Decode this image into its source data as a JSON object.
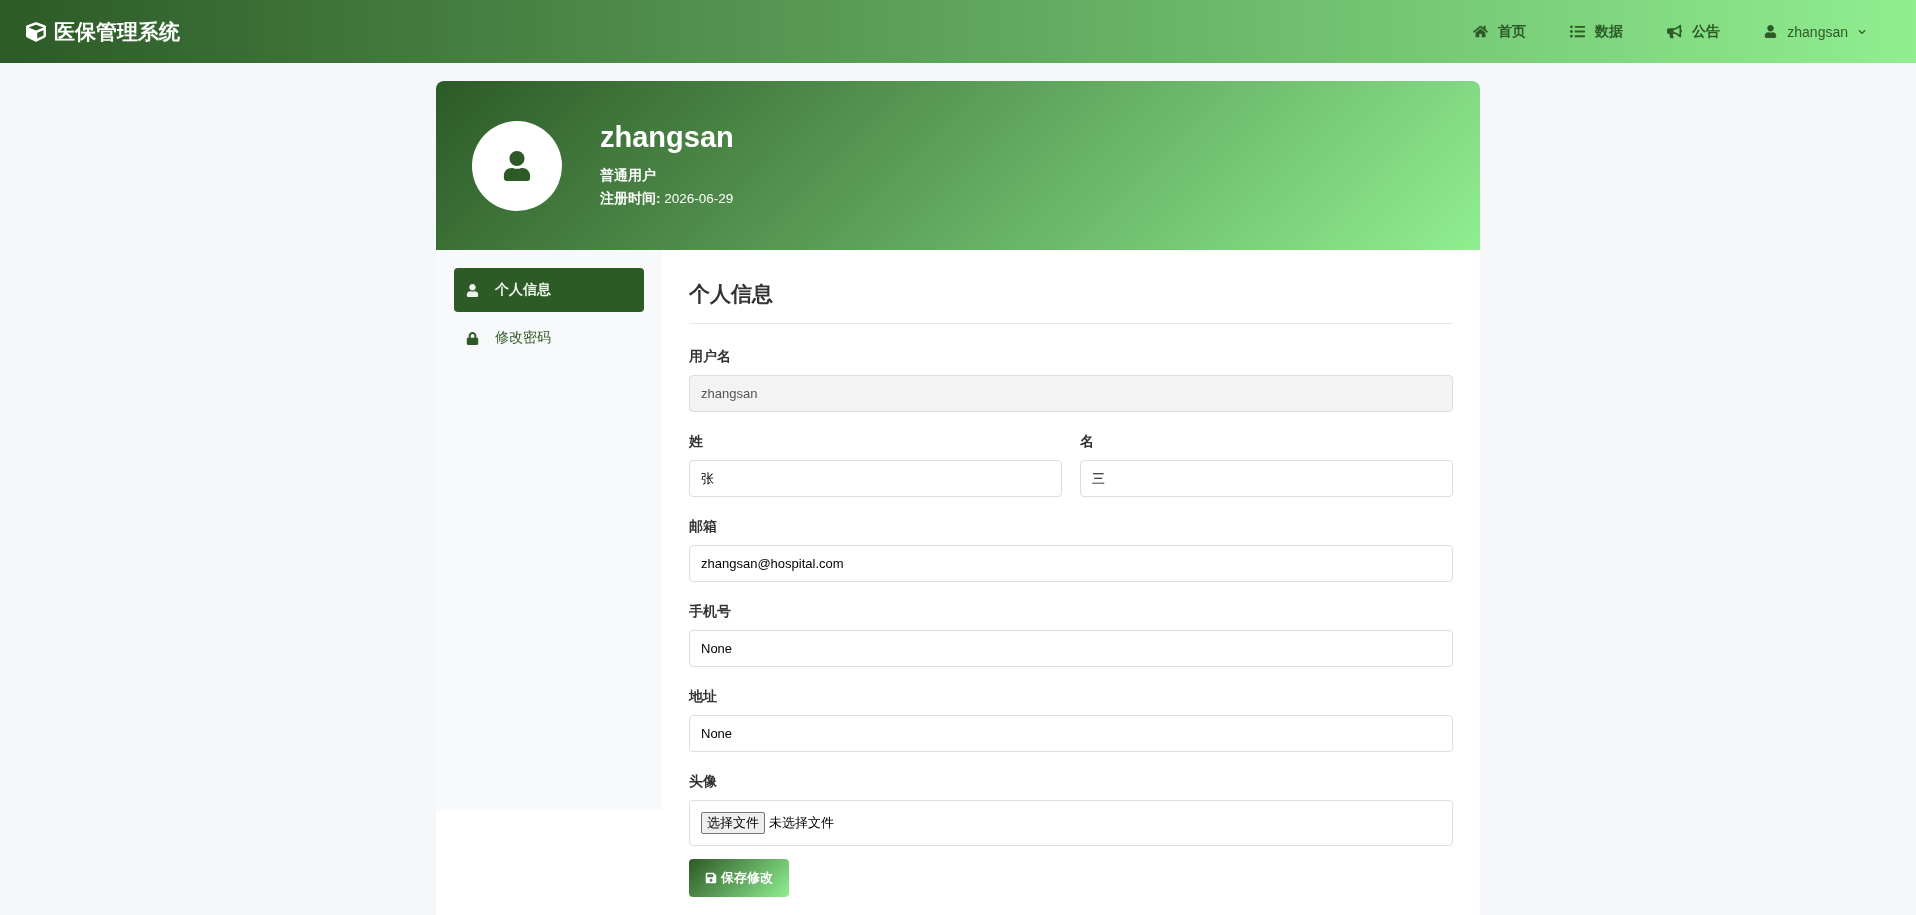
{
  "navbar": {
    "brand": "医保管理系统",
    "links": [
      "首页",
      "数据",
      "公告"
    ],
    "user": "zhangsan"
  },
  "profile": {
    "name": "zhangsan",
    "role": "普通用户",
    "registered_label": "注册时间:",
    "registered": "2026-06-29"
  },
  "sidebar": {
    "items": [
      {
        "label": "个人信息",
        "selected": true
      },
      {
        "label": "修改密码",
        "selected": false
      }
    ]
  },
  "form": {
    "title": "个人信息",
    "rows": [
      {
        "kind": "text",
        "label": "用户名",
        "value": "zhangsan",
        "disabled": true
      },
      {
        "kind": "pair",
        "fields": [
          {
            "label": "姓",
            "value": "张",
            "disabled": false
          },
          {
            "label": "名",
            "value": "三",
            "disabled": false
          }
        ]
      },
      {
        "kind": "text",
        "label": "邮箱",
        "value": "zhangsan@hospital.com",
        "disabled": false
      },
      {
        "kind": "text",
        "label": "手机号",
        "value": "None",
        "disabled": false
      },
      {
        "kind": "text",
        "label": "地址",
        "value": "None",
        "disabled": false
      },
      {
        "kind": "file",
        "label": "头像",
        "button": "选择文件",
        "status": "未选择文件"
      }
    ],
    "submit": "保存修改"
  }
}
